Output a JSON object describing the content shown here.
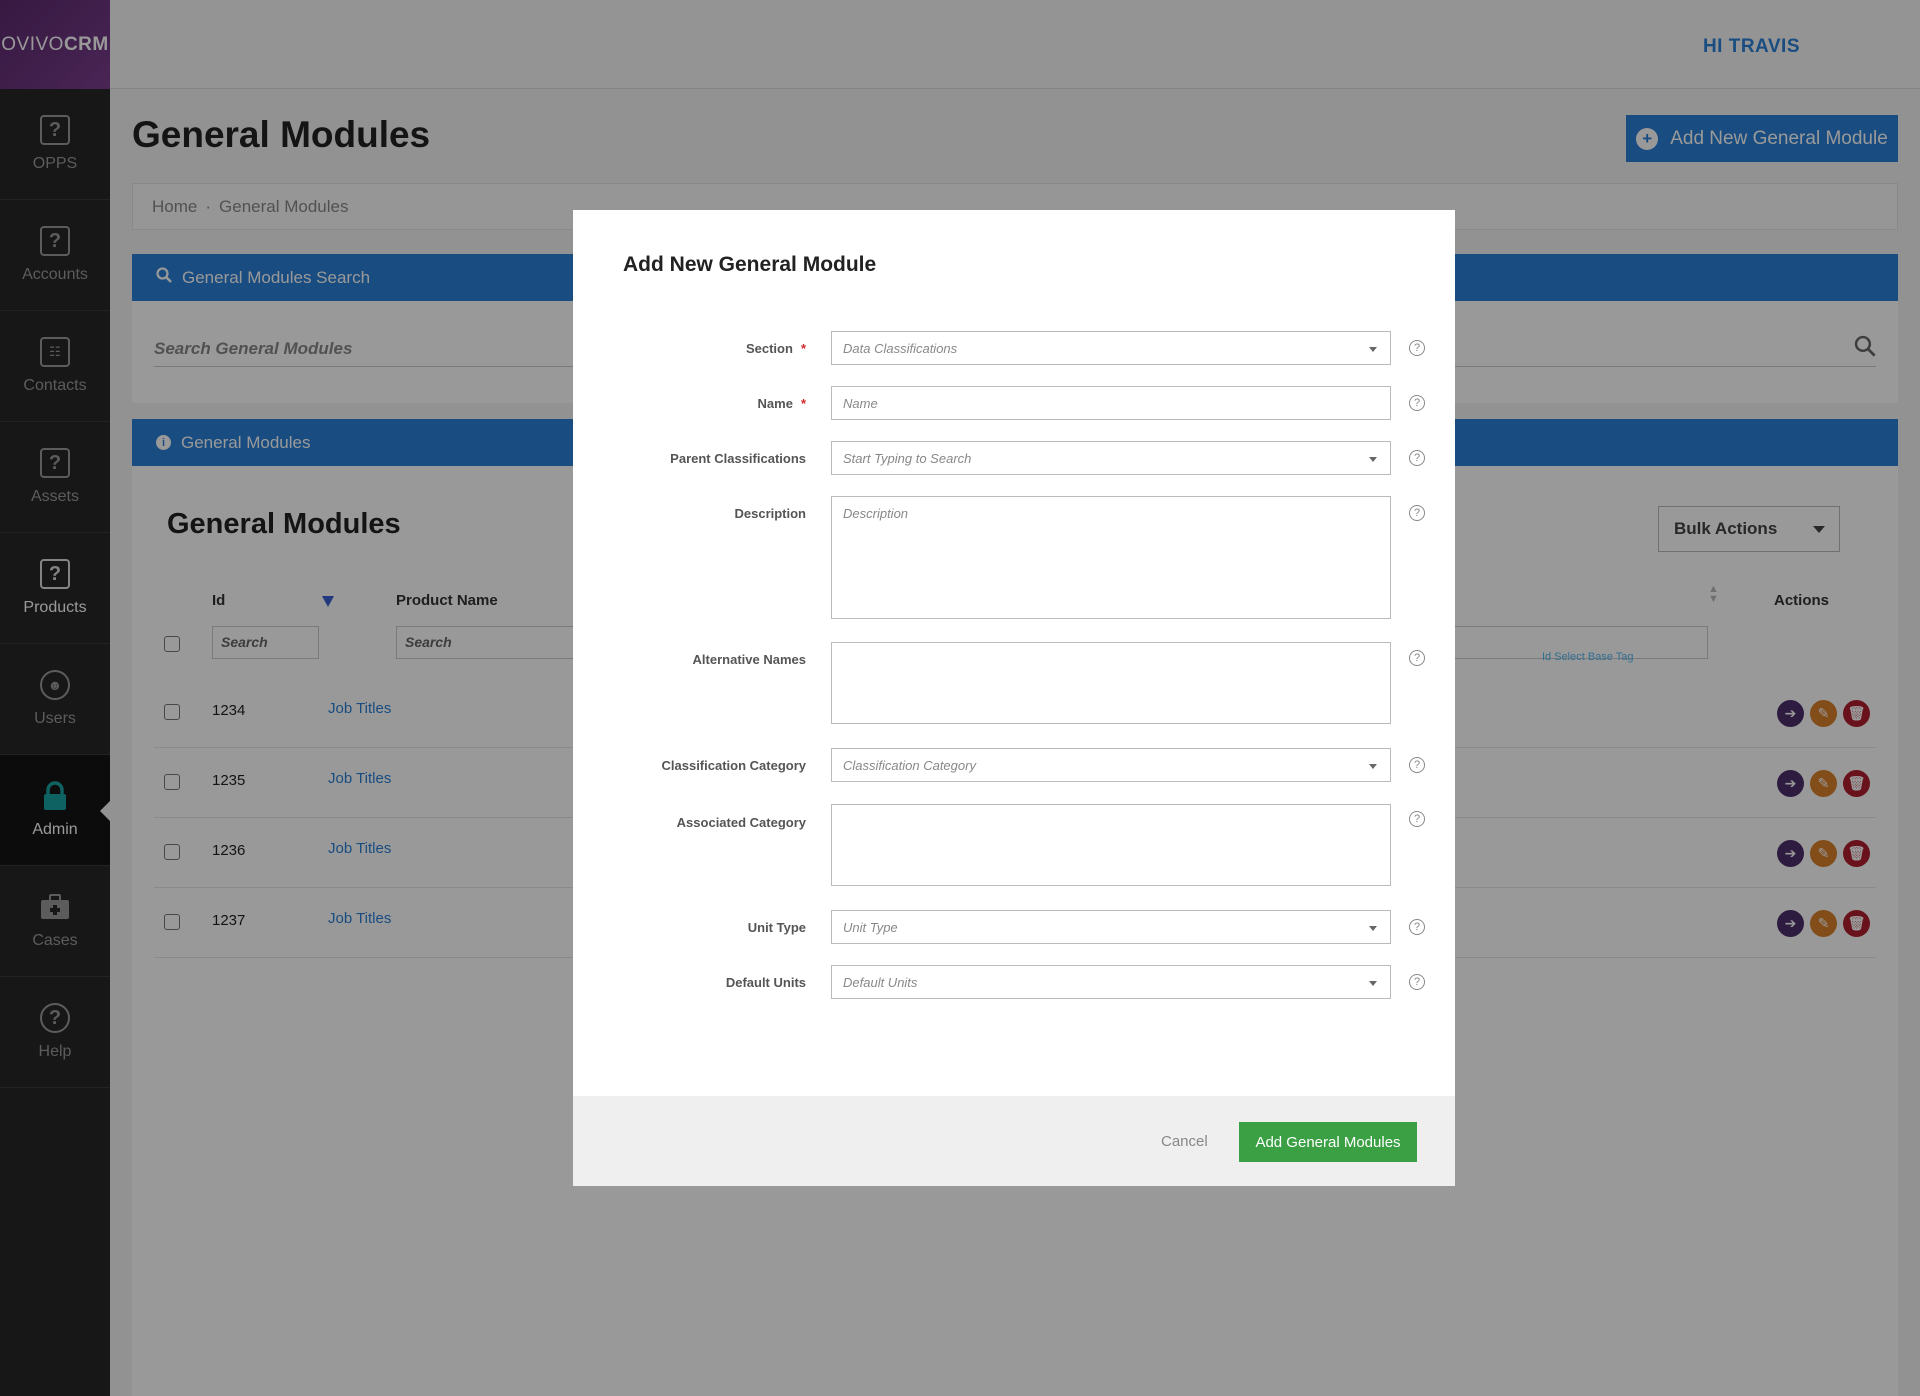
{
  "app": {
    "logo_light": "OVIVO",
    "logo_bold": "CRM",
    "greeting": "HI TRAVIS"
  },
  "sidebar": {
    "items": [
      {
        "label": "OPPS",
        "icon": "question-icon"
      },
      {
        "label": "Accounts",
        "icon": "question-icon"
      },
      {
        "label": "Contacts",
        "icon": "contact-card-icon"
      },
      {
        "label": "Assets",
        "icon": "question-icon"
      },
      {
        "label": "Products",
        "icon": "question-icon"
      },
      {
        "label": "Users",
        "icon": "user-icon"
      },
      {
        "label": "Admin",
        "icon": "lock-icon"
      },
      {
        "label": "Cases",
        "icon": "briefcase-icon"
      },
      {
        "label": "Help",
        "icon": "help-icon"
      }
    ]
  },
  "page": {
    "title": "General Modules",
    "add_button": "Add New General Module",
    "breadcrumb": {
      "home": "Home",
      "separator": "·",
      "current": "General Modules"
    }
  },
  "search_panel": {
    "header": "General Modules Search",
    "placeholder": "Search General Modules"
  },
  "list_panel": {
    "header": "General Modules",
    "title": "General Modules",
    "bulk_actions": "Bulk Actions",
    "columns": {
      "id": "Id",
      "product_name": "Product Name",
      "actions": "Actions"
    },
    "column_search_placeholder": "Search",
    "tiny_link": "Id Select Base Tag",
    "rows": [
      {
        "id": "1234",
        "name": "Job Titles"
      },
      {
        "id": "1235",
        "name": "Job Titles"
      },
      {
        "id": "1236",
        "name": "Job Titles"
      },
      {
        "id": "1237",
        "name": "Job Titles"
      }
    ]
  },
  "modal": {
    "title": "Add New General Module",
    "fields": {
      "section": {
        "label": "Section",
        "value": "Data Classifications"
      },
      "name": {
        "label": "Name",
        "placeholder": "Name"
      },
      "parent": {
        "label": "Parent Classifications",
        "placeholder": "Start Typing to Search"
      },
      "description": {
        "label": "Description",
        "placeholder": "Description"
      },
      "alt_names": {
        "label": "Alternative Names"
      },
      "class_category": {
        "label": "Classification Category",
        "placeholder": "Classification Category"
      },
      "assoc_category": {
        "label": "Associated Category"
      },
      "unit_type": {
        "label": "Unit Type",
        "placeholder": "Unit Type"
      },
      "default_units": {
        "label": "Default Units",
        "placeholder": "Default Units"
      }
    },
    "required_mark": "*",
    "help_glyph": "?",
    "cancel": "Cancel",
    "submit": "Add General Modules"
  },
  "colors": {
    "accent": "#2b7fd6",
    "success": "#3aa043",
    "logo": "#6b3480",
    "danger": "#b01e2e"
  }
}
